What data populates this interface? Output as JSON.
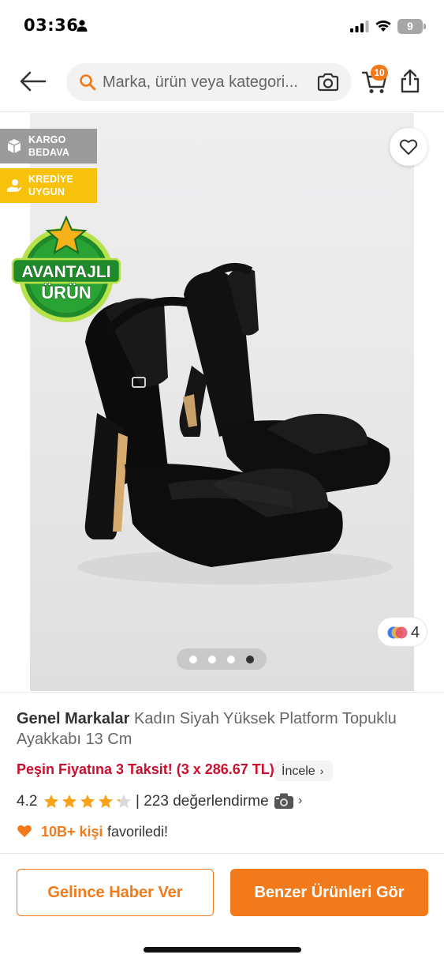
{
  "status_bar": {
    "time": "03:36",
    "battery": "9"
  },
  "header": {
    "search_placeholder": "Marka, ürün veya kategori...",
    "cart_count": "10"
  },
  "gallery": {
    "badges": [
      {
        "label": "KARGO BEDAVA",
        "color": "#9b9b9b"
      },
      {
        "label": "KREDİYE UYGUN",
        "color": "#f8c20c"
      }
    ],
    "promo_line1": "AVANTAJLI",
    "promo_line2": "ÜRÜN",
    "variant_count": "4",
    "pagination": {
      "total": 4,
      "active": 4
    }
  },
  "product": {
    "brand": "Genel Markalar",
    "name": " Kadın Siyah Yüksek Platform Topuklu Ayakkabı 13 Cm",
    "installment": "Peşin Fiyatına 3 Taksit! (3 x 286.67 TL)",
    "incele_label": "İncele",
    "rating": "4.2",
    "rating_value": 4.2,
    "rating_max": 5,
    "reviews": "| 223 değerlendirme",
    "favorites_count": "10B+ kişi",
    "favorites_suffix": "favoriledi!"
  },
  "actions": {
    "notify_label": "Gelince Haber Ver",
    "similar_label": "Benzer Ürünleri Gör"
  },
  "colors": {
    "accent": "#f27a1a",
    "installment": "#c8102e",
    "star": "#f8a21a"
  }
}
